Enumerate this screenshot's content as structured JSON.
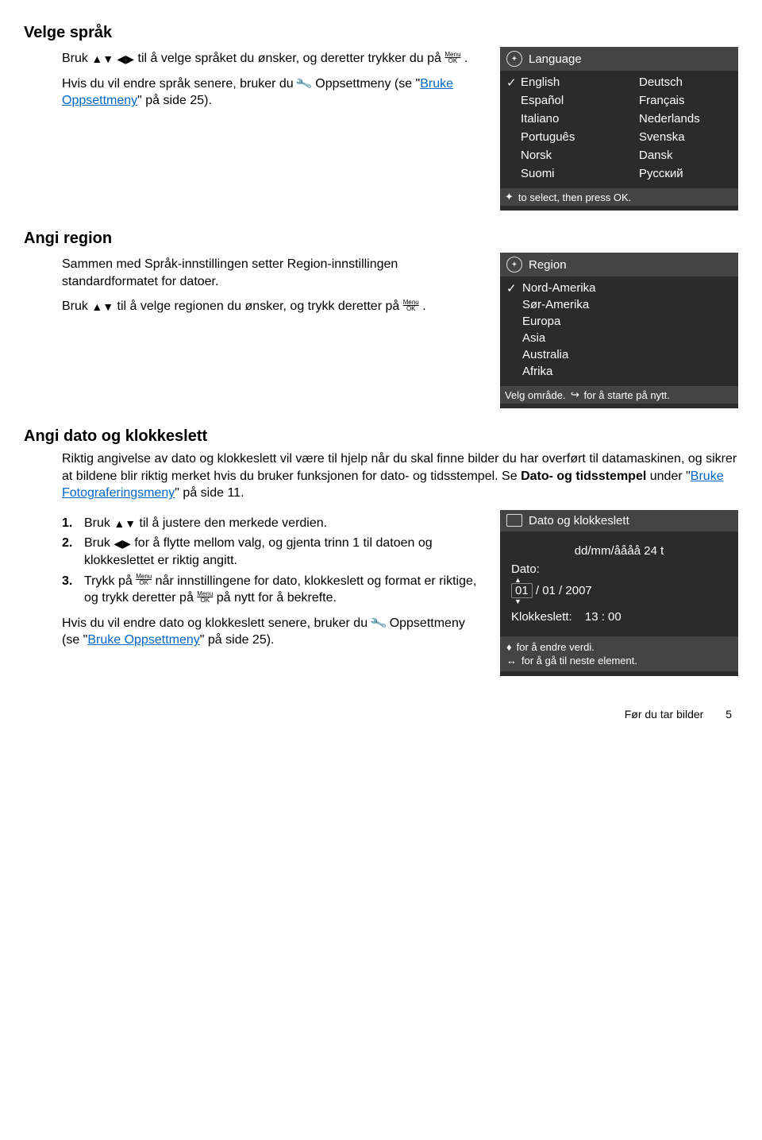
{
  "section1": {
    "heading": "Velge språk",
    "p1a": "Bruk ",
    "p1b": " til å velge språket du ønsker, og deretter trykker du på ",
    "p1c": ".",
    "p2a": "Hvis du vil endre språk senere, bruker du ",
    "p2b": " Oppsettmeny (se \"",
    "p2link": "Bruke Oppsettmeny",
    "p2c": "\" på side 25).",
    "cam": {
      "title": "Language",
      "items_left": [
        "English",
        "Español",
        "Italiano",
        "Português",
        "Norsk",
        "Suomi"
      ],
      "items_right": [
        "Deutsch",
        "Français",
        "Nederlands",
        "Svenska",
        "Dansk",
        "Русский"
      ],
      "footer": "to select, then press OK."
    }
  },
  "section2": {
    "heading": "Angi region",
    "p1": "Sammen med Språk-innstillingen setter Region-innstillingen standardformatet for datoer.",
    "p2a": "Bruk ",
    "p2b": " til å velge regionen du ønsker, og trykk deretter på ",
    "p2c": ".",
    "cam": {
      "title": "Region",
      "items": [
        "Nord-Amerika",
        "Sør-Amerika",
        "Europa",
        "Asia",
        "Australia",
        "Afrika"
      ],
      "footer_a": "Velg område.",
      "footer_b": "for å starte på nytt."
    }
  },
  "section3": {
    "heading": "Angi dato og klokkeslett",
    "intro_a": "Riktig angivelse av dato og klokkeslett vil være til hjelp når du skal finne bilder du har overført til datamaskinen, og sikrer at bildene blir riktig merket hvis du bruker funksjonen for dato- og tidsstempel. Se ",
    "intro_bold": "Dato- og tidsstempel",
    "intro_b": " under \"",
    "intro_link": "Bruke Fotograferingsmeny",
    "intro_c": "\" på side 11.",
    "steps": {
      "s1a": "Bruk ",
      "s1b": " til å justere den merkede verdien.",
      "s2a": "Bruk ",
      "s2b": " for å flytte mellom valg, og gjenta trinn 1 til datoen og klokkeslettet er riktig angitt.",
      "s3a": "Trykk på ",
      "s3b": " når innstillingene for dato, klokkeslett og format er riktige, og trykk deretter på ",
      "s3c": " på nytt for å bekrefte."
    },
    "p_after_a": "Hvis du vil endre dato og klokkeslett senere, bruker du ",
    "p_after_b": " Oppsettmeny (se \"",
    "p_after_link": "Bruke Oppsettmeny",
    "p_after_c": "\" på side 25).",
    "cam": {
      "title": "Dato og klokkeslett",
      "format": "dd/mm/åååå  24 t",
      "date_label": "Dato:",
      "date_d": "01",
      "date_m": "/ 01 / 2007",
      "time_label": "Klokkeslett:",
      "time_val": "13 : 00",
      "footer1": "for å endre verdi.",
      "footer2": "for å gå til neste element."
    }
  },
  "footer": {
    "text": "Før du tar bilder",
    "page": "5"
  },
  "labels": {
    "menu": "Menu",
    "ok": "OK",
    "num1": "1.",
    "num2": "2.",
    "num3": "3."
  }
}
